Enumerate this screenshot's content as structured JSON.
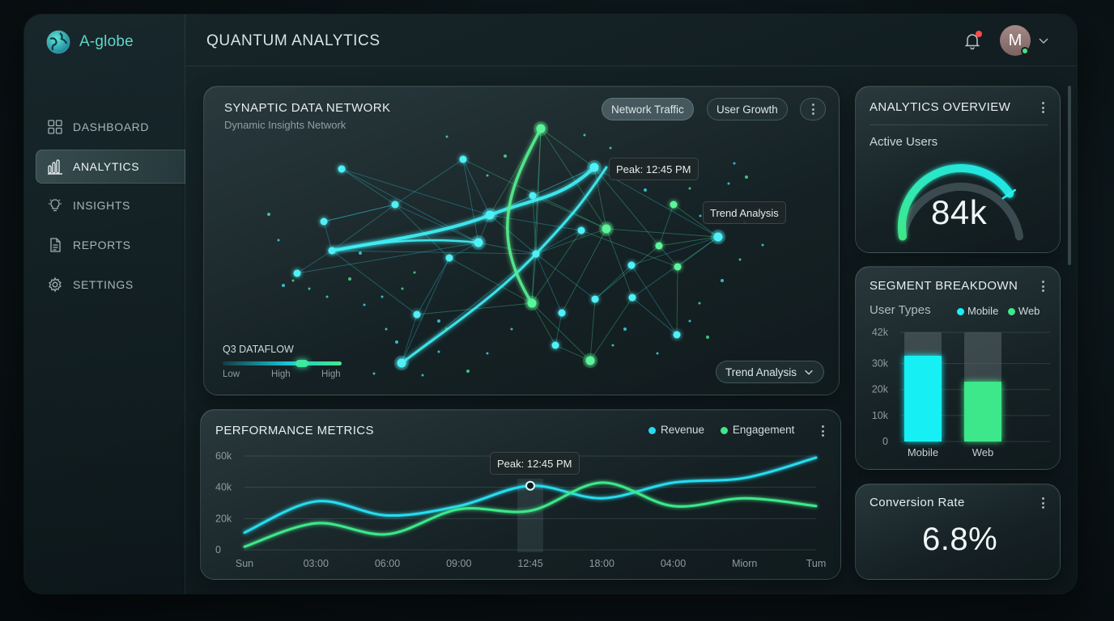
{
  "app": {
    "brand": "A-globe",
    "title": "QUANTUM ANALYTICS",
    "user_initial": "M"
  },
  "sidebar": {
    "items": [
      {
        "label": "DASHBOARD",
        "icon": "grid-icon",
        "active": false
      },
      {
        "label": "ANALYTICS",
        "icon": "bar-chart-icon",
        "active": true
      },
      {
        "label": "INSIGHTS",
        "icon": "lightbulb-icon",
        "active": false
      },
      {
        "label": "REPORTS",
        "icon": "document-icon",
        "active": false
      },
      {
        "label": "SETTINGS",
        "icon": "gear-icon",
        "active": false
      }
    ]
  },
  "network": {
    "title": "SYNAPTIC DATA NETWORK",
    "subtitle": "Dynamic Insights Network",
    "tabs": [
      "Network Traffic",
      "User Growth"
    ],
    "active_tab": "Network Traffic",
    "tooltip_peak": "Peak: 12:45 PM",
    "tooltip_trend": "Trend Analysis",
    "dataflow_label": "Q3 DATAFLOW",
    "dataflow_scale": [
      "Low",
      "High",
      "High"
    ],
    "dropdown": "Trend Analysis"
  },
  "performance": {
    "title": "PERFORMANCE METRICS",
    "tooltip": "Peak: 12:45 PM",
    "chart_data": {
      "type": "line",
      "x": [
        "Sun",
        "03:00",
        "06:00",
        "09:00",
        "12:45",
        "18:00",
        "04:00",
        "Miorn",
        "Tum"
      ],
      "ylim": [
        0,
        60000
      ],
      "yticks": [
        "0",
        "20k",
        "40k",
        "60k"
      ],
      "series": [
        {
          "name": "Revenue",
          "color": "#27dcef",
          "values": [
            11000,
            31000,
            22000,
            28000,
            41000,
            33000,
            43000,
            46000,
            59000
          ]
        },
        {
          "name": "Engagement",
          "color": "#3ee88a",
          "values": [
            2000,
            17000,
            10000,
            26000,
            25000,
            43000,
            28000,
            33000,
            28000
          ]
        }
      ],
      "highlight_x": "12:45",
      "grid": true,
      "legend": "top-right"
    }
  },
  "overview": {
    "title": "ANALYTICS OVERVIEW",
    "label": "Active Users",
    "value": "84k",
    "gauge_fraction": 0.78
  },
  "segment": {
    "title": "SEGMENT BREAKDOWN",
    "label": "User Types",
    "chart_data": {
      "type": "bar",
      "categories": [
        "Mobile",
        "Web"
      ],
      "series": [
        {
          "name": "Mobile",
          "color": "#19f0f5",
          "values": [
            33000,
            null
          ]
        },
        {
          "name": "Web",
          "color": "#3ee88a",
          "values": [
            null,
            23000
          ]
        }
      ],
      "ylim": [
        0,
        42000
      ],
      "yticks": [
        "0",
        "10k",
        "20k",
        "30k",
        "42k"
      ],
      "grid": true,
      "legend": "top-right"
    }
  },
  "conversion": {
    "title": "Conversion Rate",
    "value": "6.8%"
  }
}
